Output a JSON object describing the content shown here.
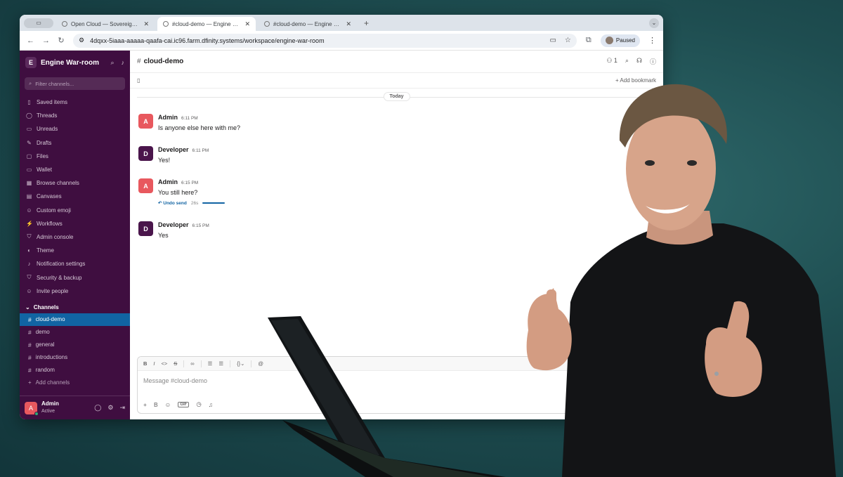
{
  "browser": {
    "tabs": [
      {
        "title": "Open Cloud — Sovereign clo"
      },
      {
        "title": "#cloud-demo — Engine War-"
      },
      {
        "title": "#cloud-demo — Engine War-"
      }
    ],
    "url": "4dqxx-5iaaa-aaaaa-qaafa-cai.ic96.farm.dfinity.systems/workspace/engine-war-room",
    "profile_status": "Paused"
  },
  "workspace": {
    "logo_letter": "E",
    "name": "Engine War-room",
    "filter_placeholder": "Filter channels...",
    "nav": [
      {
        "label": "Saved items",
        "icon": "bookmark-icon",
        "glyph": "▯"
      },
      {
        "label": "Threads",
        "icon": "threads-icon",
        "glyph": "◯"
      },
      {
        "label": "Unreads",
        "icon": "unreads-icon",
        "glyph": "▭"
      },
      {
        "label": "Drafts",
        "icon": "drafts-icon",
        "glyph": "✎"
      },
      {
        "label": "Files",
        "icon": "files-icon",
        "glyph": "▢"
      },
      {
        "label": "Wallet",
        "icon": "wallet-icon",
        "glyph": "▭"
      },
      {
        "label": "Browse channels",
        "icon": "browse-channels-icon",
        "glyph": "▦"
      },
      {
        "label": "Canvases",
        "icon": "canvases-icon",
        "glyph": "▤"
      },
      {
        "label": "Custom emoji",
        "icon": "emoji-icon",
        "glyph": "☺"
      },
      {
        "label": "Workflows",
        "icon": "workflows-icon",
        "glyph": "⚡"
      },
      {
        "label": "Admin console",
        "icon": "shield-icon",
        "glyph": "⛉"
      },
      {
        "label": "Theme",
        "icon": "theme-icon",
        "glyph": "◐"
      },
      {
        "label": "Notification settings",
        "icon": "bell-icon",
        "glyph": "♪"
      },
      {
        "label": "Security & backup",
        "icon": "security-icon",
        "glyph": "⛉"
      },
      {
        "label": "Invite people",
        "icon": "invite-icon",
        "glyph": "☺"
      }
    ],
    "channels_header": "Channels",
    "channels": [
      "cloud-demo",
      "demo",
      "general",
      "introductions",
      "random"
    ],
    "active_channel": "cloud-demo",
    "add_channels": "Add channels",
    "user": {
      "initial": "A",
      "name": "Admin",
      "status": "Active"
    }
  },
  "channel": {
    "name": "cloud-demo",
    "member_count": "1",
    "add_bookmark": "Add bookmark",
    "day_divider": "Today",
    "messages": [
      {
        "author": "Admin",
        "initial": "A",
        "role": "admin",
        "time": "6:11 PM",
        "text": "Is anyone else here with me?"
      },
      {
        "author": "Developer",
        "initial": "D",
        "role": "dev",
        "time": "6:11 PM",
        "text": "Yes!"
      },
      {
        "author": "Admin",
        "initial": "A",
        "role": "admin",
        "time": "6:15 PM",
        "text": "You still here?"
      },
      {
        "author": "Developer",
        "initial": "D",
        "role": "dev",
        "time": "6:15 PM",
        "text": "Yes"
      }
    ],
    "undo": {
      "label": "Undo send",
      "seconds": "26s"
    },
    "composer_placeholder": "Message #cloud-demo"
  },
  "colors": {
    "sidebar": "#3f0e40",
    "active_channel": "#1164a3",
    "admin_avatar": "#e8585e",
    "dev_avatar": "#4a154b"
  }
}
